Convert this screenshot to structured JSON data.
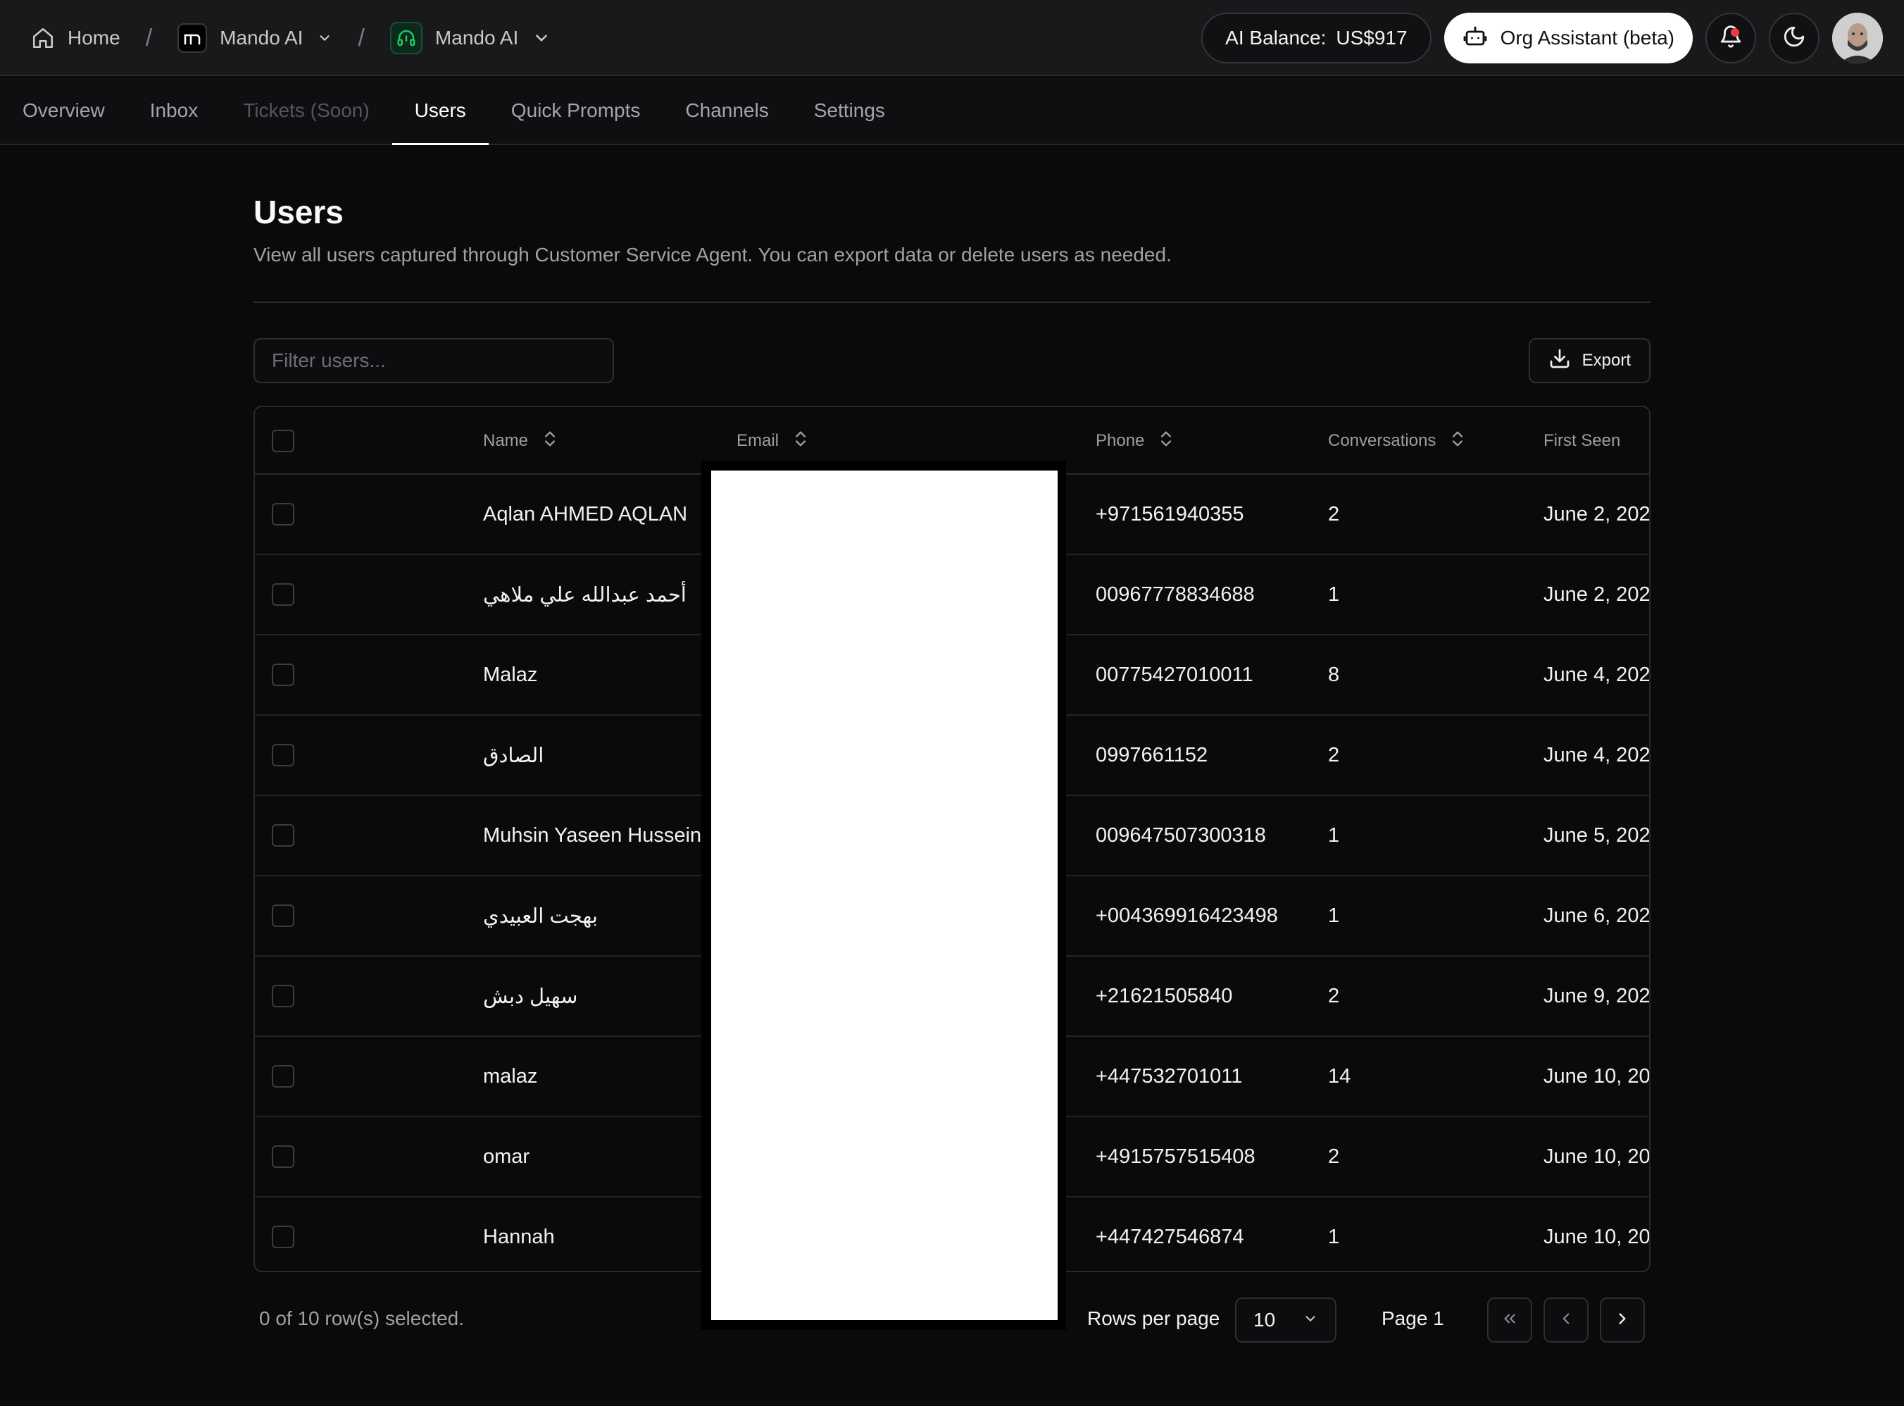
{
  "breadcrumb": {
    "home_label": "Home",
    "org_label": "Mando AI",
    "agent_label": "Mando AI",
    "separator": "/"
  },
  "header": {
    "balance_label": "AI Balance:",
    "balance_value": "US$917",
    "assistant_label": "Org Assistant (beta)"
  },
  "tabs": [
    {
      "label": "Overview",
      "state": "default"
    },
    {
      "label": "Inbox",
      "state": "default"
    },
    {
      "label": "Tickets (Soon)",
      "state": "disabled"
    },
    {
      "label": "Users",
      "state": "active"
    },
    {
      "label": "Quick Prompts",
      "state": "default"
    },
    {
      "label": "Channels",
      "state": "default"
    },
    {
      "label": "Settings",
      "state": "default"
    }
  ],
  "page": {
    "title": "Users",
    "description": "View all users captured through Customer Service Agent. You can export data or delete users as needed."
  },
  "toolbar": {
    "filter_placeholder": "Filter users...",
    "export_label": "Export"
  },
  "table": {
    "columns": [
      "Name",
      "Email",
      "Phone",
      "Conversations",
      "First Seen"
    ],
    "rows": [
      {
        "name": "Aqlan AHMED AQLAN",
        "phone": "+971561940355",
        "conversations": "2",
        "first_seen": "June 2, 202"
      },
      {
        "name": "أحمد عبدالله علي ملاهي",
        "phone": "00967778834688",
        "conversations": "1",
        "first_seen": "June 2, 202"
      },
      {
        "name": "Malaz",
        "phone": "00775427010011",
        "conversations": "8",
        "first_seen": "June 4, 202"
      },
      {
        "name": "الصادق",
        "phone": "0997661152",
        "conversations": "2",
        "first_seen": "June 4, 202"
      },
      {
        "name": "Muhsin Yaseen Hussein",
        "phone": "009647507300318",
        "conversations": "1",
        "first_seen": "June 5, 202"
      },
      {
        "name": "بهجت العبيدي",
        "phone": "+004369916423498",
        "conversations": "1",
        "first_seen": "June 6, 202"
      },
      {
        "name": "سهيل دبش",
        "phone": "+21621505840",
        "conversations": "2",
        "first_seen": "June 9, 202"
      },
      {
        "name": "malaz",
        "phone": "+447532701011",
        "conversations": "14",
        "first_seen": "June 10, 20:"
      },
      {
        "name": "omar",
        "phone": "+4915757515408",
        "conversations": "2",
        "first_seen": "June 10, 20:"
      },
      {
        "name": "Hannah",
        "phone": "+447427546874",
        "conversations": "1",
        "first_seen": "June 10, 20:"
      }
    ]
  },
  "footer": {
    "selection_text": "0 of 10 row(s) selected.",
    "rows_per_page_label": "Rows per page",
    "rows_per_page_value": "10",
    "page_label": "Page 1"
  },
  "colors": {
    "background": "#0a0a0b",
    "topbar": "#19191b",
    "accent_green": "#22c55e",
    "notification_red": "#ef3b3b"
  },
  "icons": {
    "home": "home-icon",
    "org": "mando-logo-icon",
    "agent": "headset-icon",
    "assistant": "robot-icon",
    "notifications": "bell-icon",
    "theme": "moon-icon",
    "export": "download-icon",
    "sort": "sort-icon"
  }
}
